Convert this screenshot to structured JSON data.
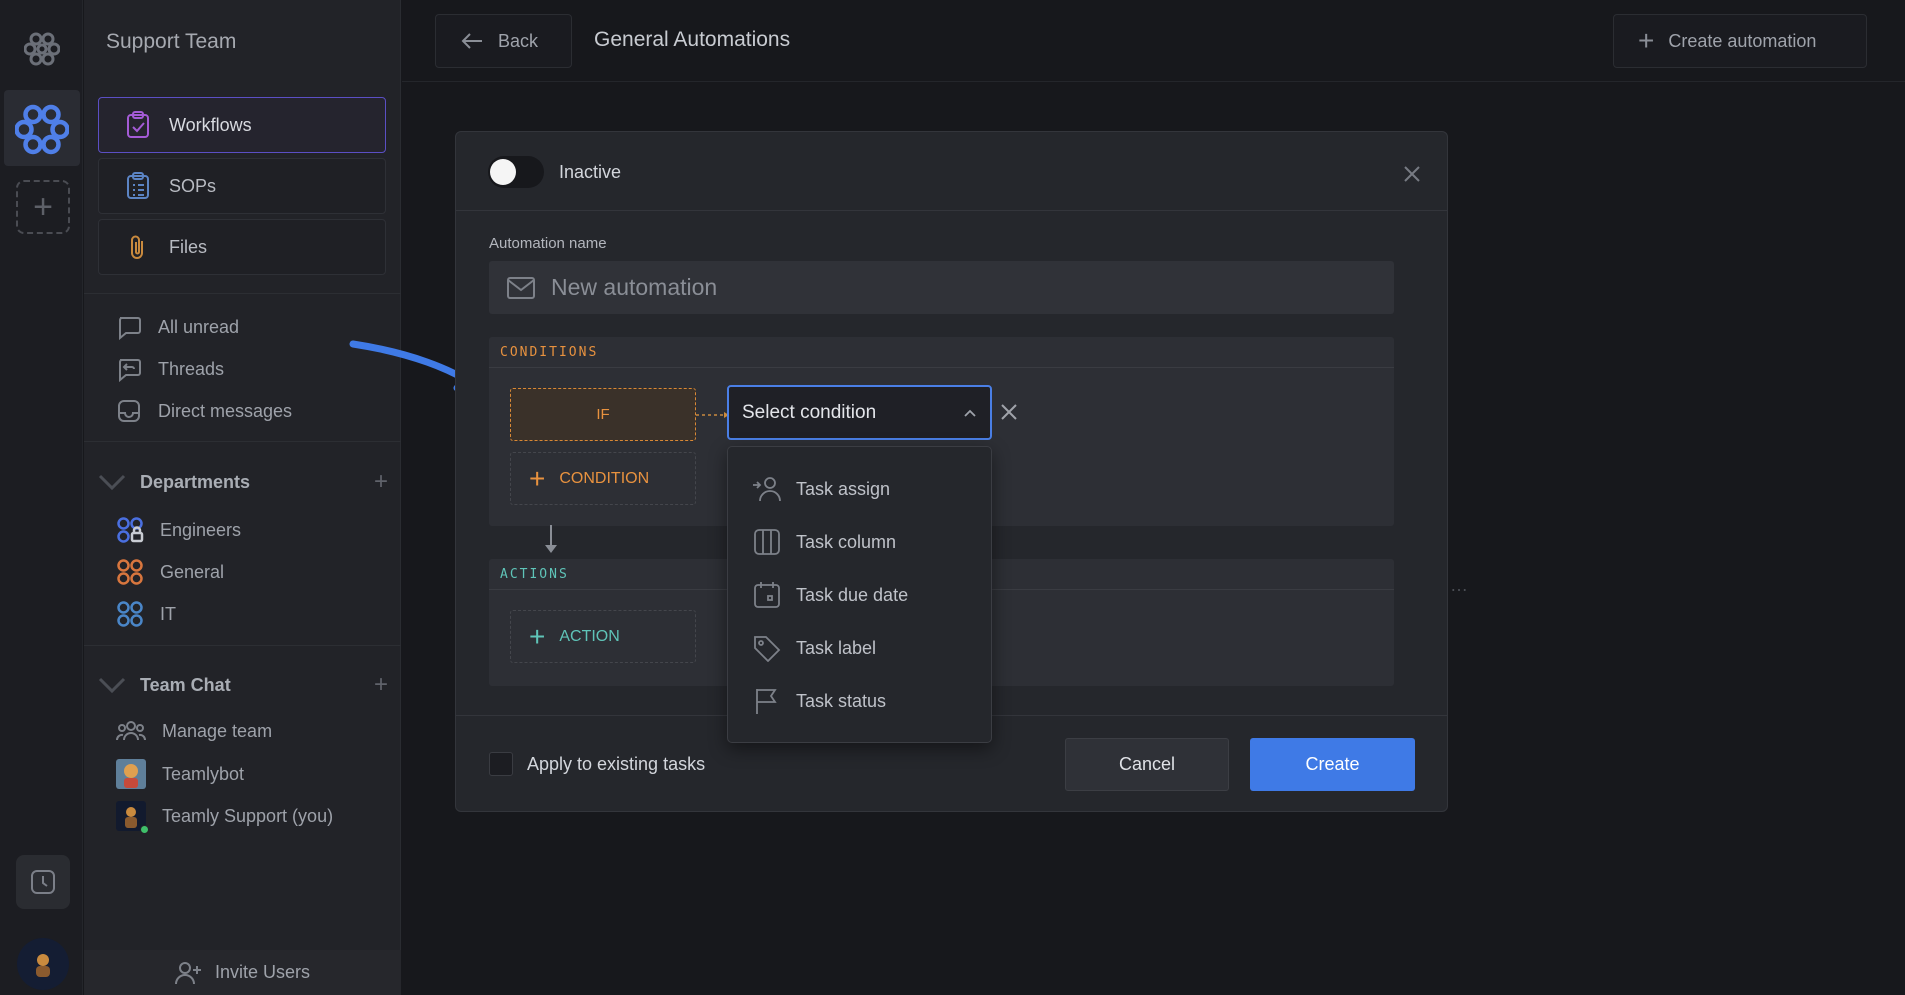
{
  "sidebar": {
    "team_name": "Support Team",
    "cards": [
      {
        "label": "Workflows",
        "icon": "clipboard-check-icon"
      },
      {
        "label": "SOPs",
        "icon": "list-icon"
      },
      {
        "label": "Files",
        "icon": "paperclip-icon"
      }
    ],
    "inbox": [
      {
        "label": "All unread",
        "icon": "chat-bubble-icon"
      },
      {
        "label": "Threads",
        "icon": "threads-icon"
      },
      {
        "label": "Direct messages",
        "icon": "inbox-icon"
      }
    ],
    "departments": {
      "title": "Departments",
      "items": [
        {
          "label": "Engineers",
          "color": "#4a6fe0"
        },
        {
          "label": "General",
          "color": "#d8763e"
        },
        {
          "label": "IT",
          "color": "#4a86c8"
        }
      ]
    },
    "team_chat": {
      "title": "Team Chat",
      "items": [
        {
          "label": "Manage team",
          "icon": "people-icon"
        },
        {
          "label": "Teamlybot",
          "icon": "bot-avatar"
        },
        {
          "label": "Teamly Support (you)",
          "icon": "user-avatar"
        }
      ]
    },
    "invite_label": "Invite Users"
  },
  "topbar": {
    "back_label": "Back",
    "title": "General Automations",
    "create_label": "Create automation"
  },
  "modal": {
    "status_label": "Inactive",
    "toggle_on": false,
    "name_label": "Automation name",
    "name_placeholder": "New automation",
    "conditions_header": "CONDITIONS",
    "if_label": "IF",
    "add_condition_label": "CONDITION",
    "actions_header": "ACTIONS",
    "add_action_label": "ACTION",
    "select_condition": "Select condition",
    "condition_options": [
      {
        "label": "Task assign",
        "icon": "user-assign-icon"
      },
      {
        "label": "Task column",
        "icon": "columns-icon"
      },
      {
        "label": "Task due date",
        "icon": "calendar-icon"
      },
      {
        "label": "Task label",
        "icon": "tag-icon"
      },
      {
        "label": "Task status",
        "icon": "flag-icon"
      }
    ],
    "apply_existing_label": "Apply to existing tasks",
    "cancel_label": "Cancel",
    "create_label": "Create"
  },
  "colors": {
    "accent_blue": "#3f7ae6",
    "conditions_orange": "#e8923f",
    "actions_teal": "#5fc4b8",
    "workflow_purple": "#9a5cd8"
  }
}
